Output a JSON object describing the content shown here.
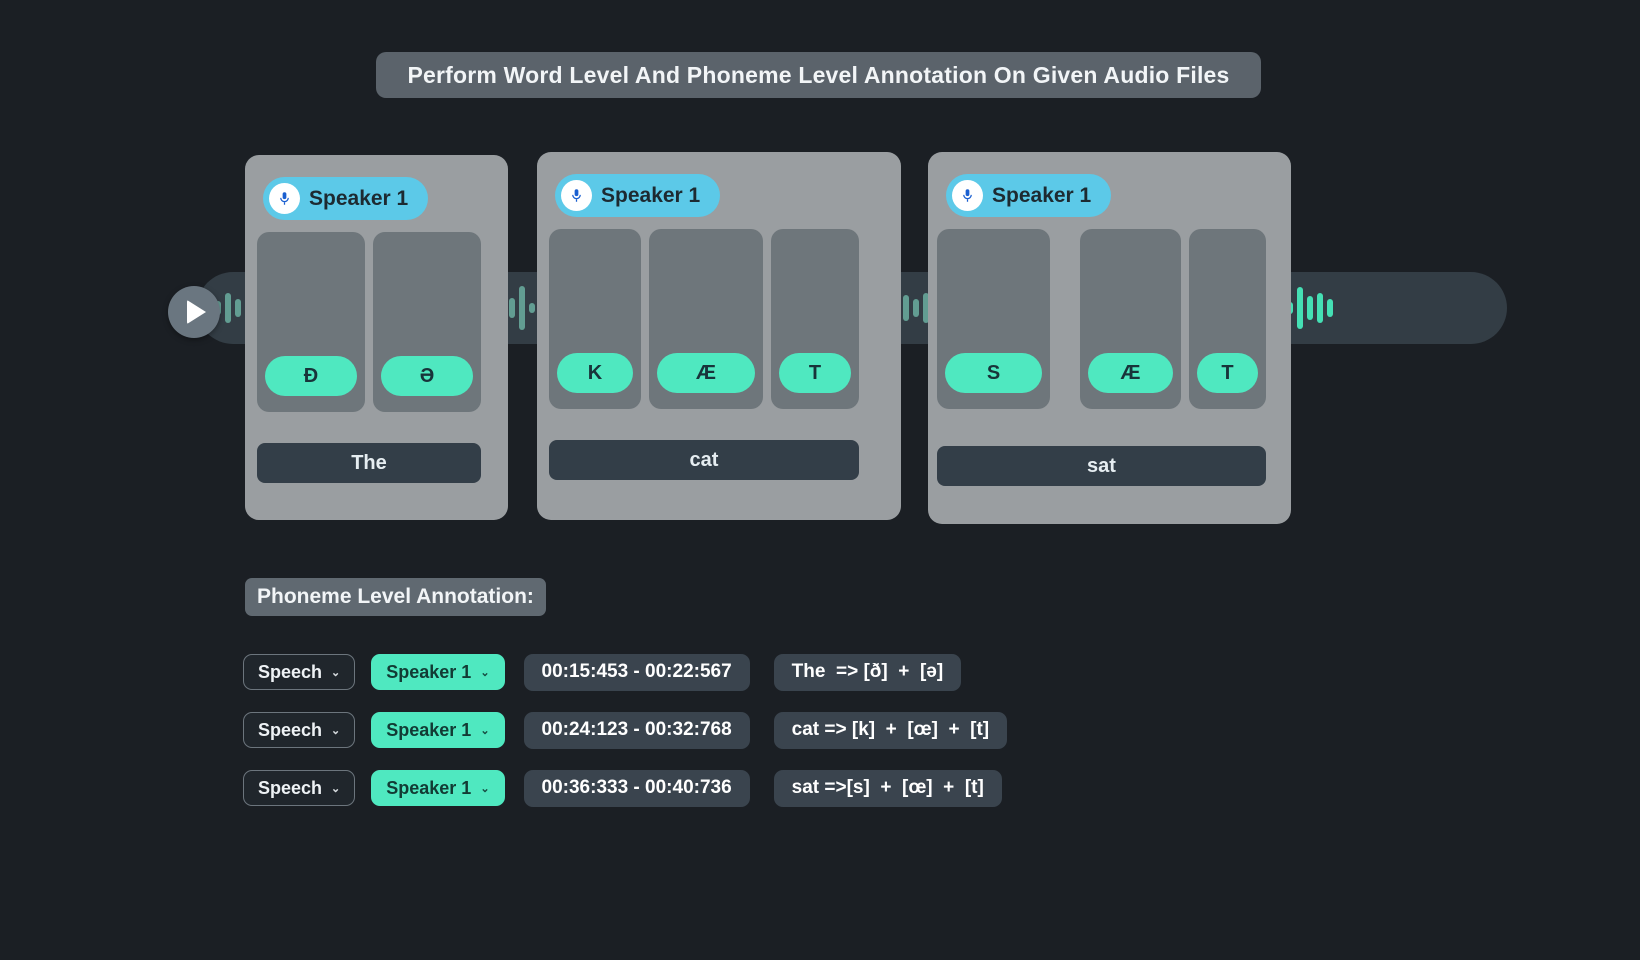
{
  "title": "Perform Word Level And Phoneme Level Annotation On Given Audio Files",
  "player": {
    "play_icon": "play-icon"
  },
  "groups": [
    {
      "speaker": "Speaker 1",
      "mic_icon": "microphone-icon",
      "word": "The",
      "phonemes": [
        "Ð",
        "Ə"
      ]
    },
    {
      "speaker": "Speaker 1",
      "mic_icon": "microphone-icon",
      "word": "cat",
      "phonemes": [
        "K",
        "Æ",
        "T"
      ]
    },
    {
      "speaker": "Speaker 1",
      "mic_icon": "microphone-icon",
      "word": "sat",
      "phonemes": [
        "S",
        "Æ",
        "T"
      ]
    }
  ],
  "section": {
    "heading": "Phoneme Level Annotation:"
  },
  "annotations": [
    {
      "type": "Speech",
      "speaker": "Speaker 1",
      "time": "00:15:453 - 00:22:567",
      "transcription": "The  => [ð]  +  [ə]"
    },
    {
      "type": "Speech",
      "speaker": "Speaker 1",
      "time": "00:24:123 - 00:32:768",
      "transcription": "cat => [k]  +  [œ]  +  [t]"
    },
    {
      "type": "Speech",
      "speaker": "Speaker 1",
      "time": "00:36:333 - 00:40:736",
      "transcription": "sat =>[s]  +  [œ]  +  [t]"
    }
  ],
  "colors": {
    "background": "#1b1f24",
    "mint": "#4fe8c0",
    "speaker_blue": "#5cc9e8",
    "panel_grey": "#9a9ea1",
    "cell_grey": "#6e767b",
    "dark_pill": "#3a444e"
  },
  "chevron": "⌄"
}
